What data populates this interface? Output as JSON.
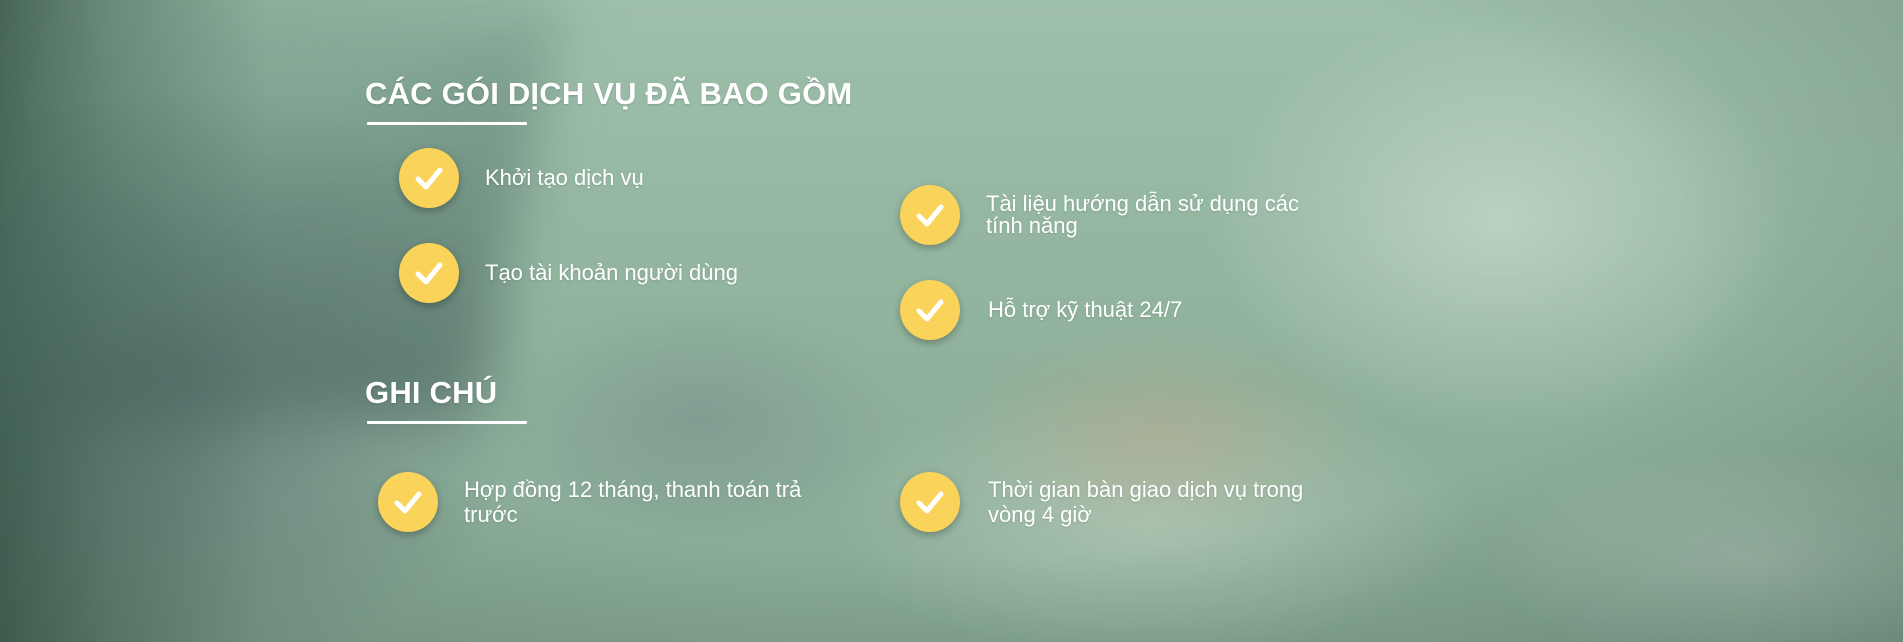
{
  "services": {
    "title": "CÁC GÓI DỊCH VỤ ĐÃ BAO GỒM",
    "items": [
      {
        "label": "Khởi tạo dịch vụ",
        "icon": "check-circle-icon"
      },
      {
        "label": "Tạo tài khoản người dùng",
        "icon": "check-circle-icon"
      },
      {
        "label": "Tài liệu hướng dẫn sử dụng các tính năng",
        "icon": "check-circle-icon"
      },
      {
        "label": "Hỗ trợ kỹ thuật 24/7",
        "icon": "check-circle-icon"
      }
    ]
  },
  "notes": {
    "title": "GHI CHÚ",
    "items": [
      {
        "label": "Hợp đồng 12 tháng, thanh toán trả trước",
        "icon": "check-circle-icon"
      },
      {
        "label": "Thời gian bàn giao dịch vụ trong vòng 4 giờ",
        "icon": "check-circle-icon"
      }
    ]
  },
  "colors": {
    "check_fill": "#f9d35a",
    "text": "#ffffff",
    "background_tint": "#9bb9a6"
  }
}
